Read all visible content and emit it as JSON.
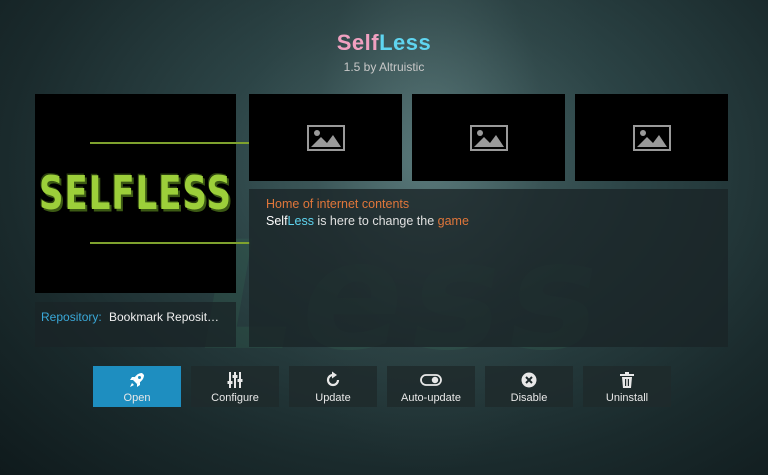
{
  "addon": {
    "title_part1": "Self",
    "title_part2": "Less",
    "version_line": "1.5 by Altruistic",
    "logo_text": "SELFLESS"
  },
  "description": {
    "heading": "Home of internet contents",
    "part_self": "Self",
    "part_less": "Less",
    "part_middle": " is here to change the ",
    "part_game": "game"
  },
  "repository": {
    "label": "Repository:",
    "value": "Bookmark Reposit…"
  },
  "buttons": [
    {
      "label": "Open",
      "icon": "rocket-icon"
    },
    {
      "label": "Configure",
      "icon": "sliders-icon"
    },
    {
      "label": "Update",
      "icon": "refresh-icon"
    },
    {
      "label": "Auto-update",
      "icon": "toggle-icon"
    },
    {
      "label": "Disable",
      "icon": "disable-icon"
    },
    {
      "label": "Uninstall",
      "icon": "trash-icon"
    }
  ],
  "colors": {
    "title_pink": "#f0a0c0",
    "accent_cyan": "#5fd5f0",
    "accent_orange": "#e0763a",
    "button_active": "#1e8ec0",
    "logo_green": "#9ccf3a"
  }
}
